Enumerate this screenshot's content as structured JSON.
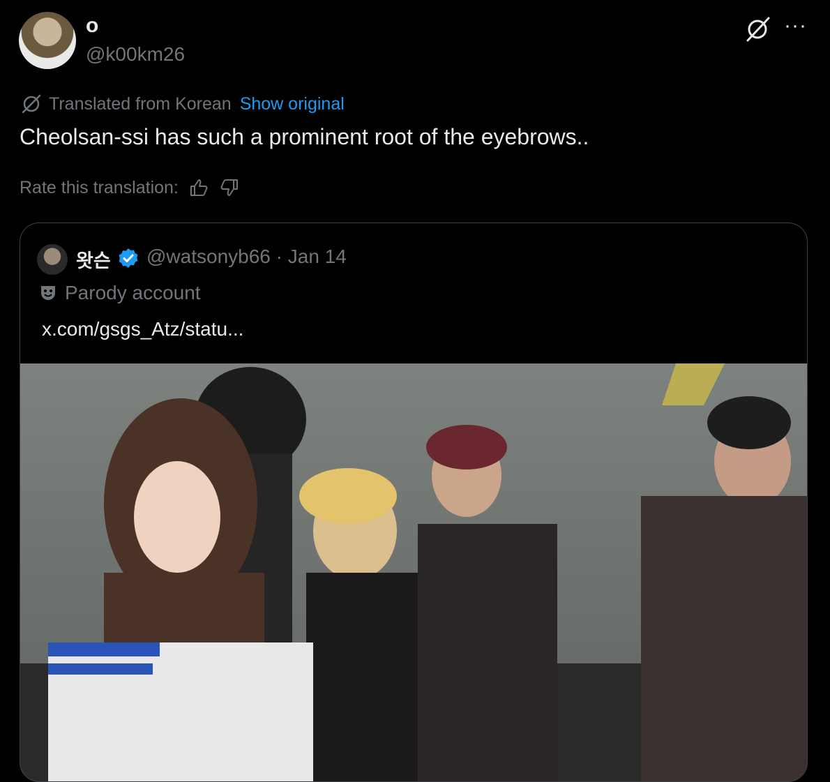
{
  "tweet": {
    "display_name": "o",
    "handle": "@k00km26",
    "translated_label": "Translated from Korean",
    "show_original_label": "Show original",
    "text": "Cheolsan-ssi has such a prominent root of the eyebrows..",
    "rate_label": "Rate this translation:"
  },
  "quote": {
    "display_name": "왓슨",
    "handle_date": "@watsonyb66 · Jan 14",
    "parody_label": "Parody account",
    "link_text": "x.com/gsgs_Atz/statu..."
  },
  "icons": {
    "grok": "grok-icon",
    "more": "more-icon",
    "translate": "translate-icon",
    "thumbs_up": "thumbs-up-icon",
    "thumbs_down": "thumbs-down-icon",
    "verified": "verified-badge-icon",
    "parody": "theater-mask-icon"
  },
  "colors": {
    "background": "#000000",
    "text": "#e7e9ea",
    "muted": "#71767b",
    "link": "#1d9bf0",
    "verified": "#1d9bf0"
  }
}
